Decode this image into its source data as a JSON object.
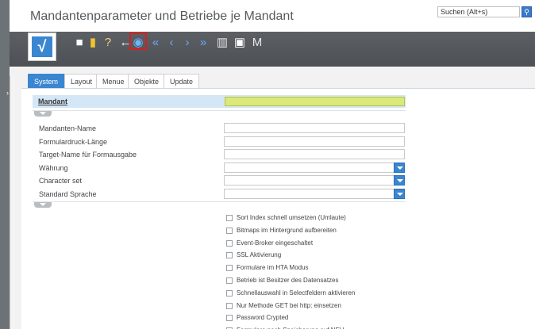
{
  "window": {
    "title": "Mandantenparameter und Betriebe je Mandant"
  },
  "search": {
    "placeholder": "Suchen (Alt+s)"
  },
  "toolbar": {
    "items": [
      {
        "name": "new-document-icon",
        "glyph": "■",
        "color": "#ffffff"
      },
      {
        "name": "book-icon",
        "glyph": "▮",
        "color": "#f2c12e"
      },
      {
        "name": "help-icon",
        "glyph": "?",
        "color": "#f0d27a"
      },
      {
        "name": "back-arrow-icon",
        "glyph": "←",
        "color": "#ffffff"
      },
      {
        "name": "search-record-icon",
        "glyph": "◉",
        "color": "#6fb4ff"
      },
      {
        "name": "first-record-icon",
        "glyph": "«",
        "color": "#6fa8ff"
      },
      {
        "name": "previous-record-icon",
        "glyph": "‹",
        "color": "#6fa8ff"
      },
      {
        "name": "next-record-icon",
        "glyph": "›",
        "color": "#6fa8ff"
      },
      {
        "name": "last-record-icon",
        "glyph": "»",
        "color": "#6fa8ff"
      },
      {
        "name": "report-icon",
        "glyph": "▥",
        "color": "#e6e6e6"
      },
      {
        "name": "copy-icon",
        "glyph": "▣",
        "color": "#ffffff"
      },
      {
        "name": "m-icon",
        "glyph": "M",
        "color": "#e6e6e6"
      }
    ],
    "check_glyph": "√"
  },
  "tabs": [
    "System",
    "Layout",
    "Menue",
    "Objekte",
    "Update"
  ],
  "mandant": {
    "label": "Mandant"
  },
  "fields": [
    {
      "label": "Mandanten-Name",
      "dropdown": false
    },
    {
      "label": "Formulardruck-Länge",
      "dropdown": false
    },
    {
      "label": "Target-Name für Formausgabe",
      "dropdown": false
    },
    {
      "label": "Währung",
      "dropdown": true
    },
    {
      "label": "Character set",
      "dropdown": true
    },
    {
      "label": "Standard Sprache",
      "dropdown": true
    }
  ],
  "checkboxes": [
    "Sort Index schnell umsetzen (Umlaute)",
    "Bitmaps im Hintergrund aufbereiten",
    "Event-Broker eingeschaltet",
    "SSL Aktivierung",
    "Formulare im HTA Modus",
    "Betrieb ist Besitzer des Datensatzes",
    "Schnellauswahl in Selectfeldern aktivieren",
    "Nur Methode GET bei http: einsetzen",
    "Password Crypted",
    "Formulare nach Speicherung auf NEU"
  ],
  "colors": {
    "accent": "#3a86d1",
    "mandant_input": "#dbe87a",
    "highlight": "#d62020"
  }
}
